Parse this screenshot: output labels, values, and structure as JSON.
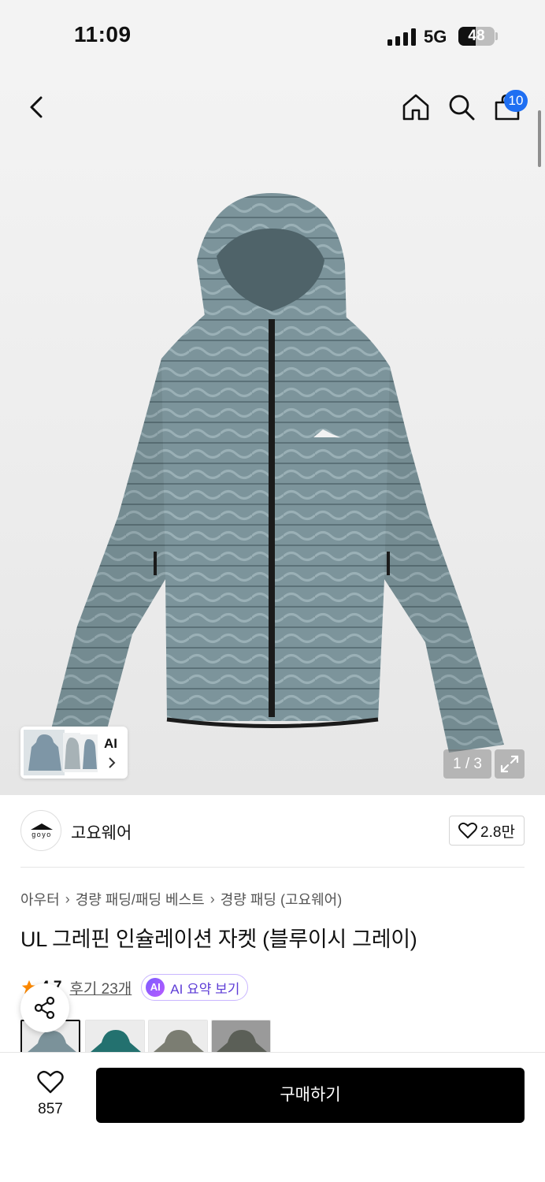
{
  "status_bar": {
    "time": "11:09",
    "network": "5G",
    "battery": "48",
    "battery_level": 0.48
  },
  "header": {
    "cart_badge": "10",
    "icons": [
      "back-icon",
      "home-icon",
      "search-icon",
      "cart-icon"
    ]
  },
  "gallery": {
    "ai_label": "AI",
    "counter": "1 / 3",
    "accent_color": "#6f8a92"
  },
  "brand": {
    "name": "고요웨어",
    "logo_text": "goyo",
    "likes": "2.8만"
  },
  "breadcrumb": [
    "아우터",
    "경량 패딩/패딩 베스트",
    "경량 패딩 (고요웨어)"
  ],
  "product": {
    "title": "UL 그레핀 인슐레이션 자켓 (블루이시 그레이)",
    "rating": "4.7",
    "reviews": "후기 23개",
    "ai_badge": "AI",
    "ai_summary": "AI 요약 보기",
    "colors": [
      "#7b929a",
      "#23716f",
      "#7b7d72",
      "#5b5f57"
    ]
  },
  "bottom_bar": {
    "wish_count": "857",
    "buy_label": "구매하기"
  }
}
